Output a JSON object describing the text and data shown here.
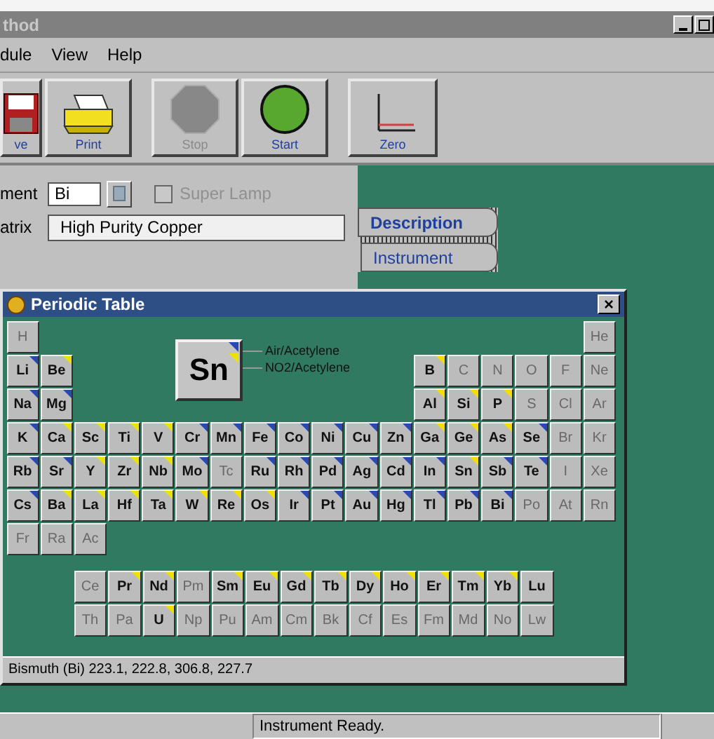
{
  "window": {
    "title": "thod"
  },
  "menu": [
    {
      "label": "dule"
    },
    {
      "label": "View"
    },
    {
      "label": "Help"
    }
  ],
  "toolbar": [
    {
      "kind": "save",
      "label": "ve",
      "disabled": false
    },
    {
      "kind": "print",
      "label": "Print",
      "disabled": false
    },
    {
      "kind": "stop",
      "label": "Stop",
      "disabled": true
    },
    {
      "kind": "start",
      "label": "Start",
      "disabled": false
    },
    {
      "kind": "zero",
      "label": "Zero",
      "disabled": false
    }
  ],
  "form": {
    "element_label": "ment",
    "element_value": "Bi",
    "super_lamp": {
      "label": "Super Lamp",
      "checked": false,
      "disabled": true
    },
    "matrix_label": "atrix",
    "matrix_value": "High Purity Copper"
  },
  "tabs": [
    {
      "label": "Description",
      "selected": true
    },
    {
      "label": "Instrument",
      "selected": false
    }
  ],
  "periodic_table": {
    "title": "Periodic Table",
    "close": "×",
    "selected_symbol": "Sn",
    "legend": [
      {
        "label": "Air/Acetylene",
        "color": "#2848b8"
      },
      {
        "label": "NO2/Acetylene",
        "color": "#f0e000"
      }
    ],
    "rows": [
      {
        "left": [
          {
            "symbol": "H",
            "disabled": true
          }
        ],
        "right": [
          {
            "symbol": "He",
            "disabled": true
          }
        ]
      },
      {
        "left": [
          {
            "symbol": "Li",
            "disabled": false,
            "color": "#2848b8"
          },
          {
            "symbol": "Be",
            "disabled": false,
            "color": "#f0e000"
          }
        ],
        "right": [
          {
            "symbol": "B",
            "disabled": false,
            "color": "#f0e000"
          },
          {
            "symbol": "C",
            "disabled": true
          },
          {
            "symbol": "N",
            "disabled": true
          },
          {
            "symbol": "O",
            "disabled": true
          },
          {
            "symbol": "F",
            "disabled": true
          },
          {
            "symbol": "Ne",
            "disabled": true
          }
        ]
      },
      {
        "left": [
          {
            "symbol": "Na",
            "disabled": false,
            "color": "#2848b8"
          },
          {
            "symbol": "Mg",
            "disabled": false,
            "color": "#2848b8"
          }
        ],
        "right": [
          {
            "symbol": "Al",
            "disabled": false,
            "color": "#f0e000"
          },
          {
            "symbol": "Si",
            "disabled": false,
            "color": "#f0e000"
          },
          {
            "symbol": "P",
            "disabled": false,
            "color": "#f0e000"
          },
          {
            "symbol": "S",
            "disabled": true
          },
          {
            "symbol": "Cl",
            "disabled": true
          },
          {
            "symbol": "Ar",
            "disabled": true
          }
        ]
      },
      {
        "left": [
          {
            "symbol": "K",
            "disabled": false,
            "color": "#2848b8"
          },
          {
            "symbol": "Ca",
            "disabled": false,
            "color": "#f0e000"
          },
          {
            "symbol": "Sc",
            "disabled": false,
            "color": "#f0e000"
          },
          {
            "symbol": "Ti",
            "disabled": false,
            "color": "#f0e000"
          },
          {
            "symbol": "V",
            "disabled": false,
            "color": "#f0e000"
          },
          {
            "symbol": "Cr",
            "disabled": false,
            "color": "#2848b8"
          },
          {
            "symbol": "Mn",
            "disabled": false,
            "color": "#2848b8"
          },
          {
            "symbol": "Fe",
            "disabled": false,
            "color": "#2848b8"
          },
          {
            "symbol": "Co",
            "disabled": false,
            "color": "#2848b8"
          },
          {
            "symbol": "Ni",
            "disabled": false,
            "color": "#2848b8"
          },
          {
            "symbol": "Cu",
            "disabled": false,
            "color": "#2848b8"
          },
          {
            "symbol": "Zn",
            "disabled": false,
            "color": "#2848b8"
          },
          {
            "symbol": "Ga",
            "disabled": false,
            "color": "#f0e000"
          },
          {
            "symbol": "Ge",
            "disabled": false,
            "color": "#f0e000"
          },
          {
            "symbol": "As",
            "disabled": false,
            "color": "#f0e000"
          },
          {
            "symbol": "Se",
            "disabled": false,
            "color": "#2848b8"
          },
          {
            "symbol": "Br",
            "disabled": true
          },
          {
            "symbol": "Kr",
            "disabled": true
          }
        ],
        "right": []
      },
      {
        "left": [
          {
            "symbol": "Rb",
            "disabled": false,
            "color": "#2848b8"
          },
          {
            "symbol": "Sr",
            "disabled": false,
            "color": "#2848b8"
          },
          {
            "symbol": "Y",
            "disabled": false,
            "color": "#f0e000"
          },
          {
            "symbol": "Zr",
            "disabled": false,
            "color": "#f0e000"
          },
          {
            "symbol": "Nb",
            "disabled": false,
            "color": "#f0e000"
          },
          {
            "symbol": "Mo",
            "disabled": false,
            "color": "#2848b8"
          },
          {
            "symbol": "Tc",
            "disabled": true
          },
          {
            "symbol": "Ru",
            "disabled": false,
            "color": "#2848b8"
          },
          {
            "symbol": "Rh",
            "disabled": false,
            "color": "#2848b8"
          },
          {
            "symbol": "Pd",
            "disabled": false,
            "color": "#2848b8"
          },
          {
            "symbol": "Ag",
            "disabled": false,
            "color": "#2848b8"
          },
          {
            "symbol": "Cd",
            "disabled": false,
            "color": "#2848b8"
          },
          {
            "symbol": "In",
            "disabled": false,
            "color": "#2848b8"
          },
          {
            "symbol": "Sn",
            "disabled": false,
            "color": "#f0e000"
          },
          {
            "symbol": "Sb",
            "disabled": false,
            "color": "#2848b8"
          },
          {
            "symbol": "Te",
            "disabled": false,
            "color": "#2848b8"
          },
          {
            "symbol": "I",
            "disabled": true
          },
          {
            "symbol": "Xe",
            "disabled": true
          }
        ],
        "right": []
      },
      {
        "left": [
          {
            "symbol": "Cs",
            "disabled": false,
            "color": "#2848b8"
          },
          {
            "symbol": "Ba",
            "disabled": false,
            "color": "#f0e000"
          },
          {
            "symbol": "La",
            "disabled": false,
            "color": "#f0e000"
          },
          {
            "symbol": "Hf",
            "disabled": false,
            "color": "#f0e000"
          },
          {
            "symbol": "Ta",
            "disabled": false,
            "color": "#f0e000"
          },
          {
            "symbol": "W",
            "disabled": false,
            "color": "#f0e000"
          },
          {
            "symbol": "Re",
            "disabled": false,
            "color": "#f0e000"
          },
          {
            "symbol": "Os",
            "disabled": false,
            "color": "#f0e000"
          },
          {
            "symbol": "Ir",
            "disabled": false,
            "color": "#2848b8"
          },
          {
            "symbol": "Pt",
            "disabled": false,
            "color": "#2848b8"
          },
          {
            "symbol": "Au",
            "disabled": false,
            "color": "#2848b8"
          },
          {
            "symbol": "Hg",
            "disabled": false,
            "color": "#2848b8"
          },
          {
            "symbol": "Tl",
            "disabled": false,
            "color": "#2848b8"
          },
          {
            "symbol": "Pb",
            "disabled": false,
            "color": "#2848b8"
          },
          {
            "symbol": "Bi",
            "disabled": false,
            "color": "#2848b8"
          },
          {
            "symbol": "Po",
            "disabled": true
          },
          {
            "symbol": "At",
            "disabled": true
          },
          {
            "symbol": "Rn",
            "disabled": true
          }
        ],
        "right": []
      },
      {
        "left": [
          {
            "symbol": "Fr",
            "disabled": true
          },
          {
            "symbol": "Ra",
            "disabled": true
          },
          {
            "symbol": "Ac",
            "disabled": true
          }
        ],
        "right": []
      }
    ],
    "f_block": [
      [
        {
          "symbol": "Ce",
          "disabled": true
        },
        {
          "symbol": "Pr",
          "disabled": false,
          "color": "#f0e000"
        },
        {
          "symbol": "Nd",
          "disabled": false,
          "color": "#f0e000"
        },
        {
          "symbol": "Pm",
          "disabled": true
        },
        {
          "symbol": "Sm",
          "disabled": false,
          "color": "#f0e000"
        },
        {
          "symbol": "Eu",
          "disabled": false,
          "color": "#f0e000"
        },
        {
          "symbol": "Gd",
          "disabled": false,
          "color": "#f0e000"
        },
        {
          "symbol": "Tb",
          "disabled": false,
          "color": "#f0e000"
        },
        {
          "symbol": "Dy",
          "disabled": false,
          "color": "#f0e000"
        },
        {
          "symbol": "Ho",
          "disabled": false,
          "color": "#f0e000"
        },
        {
          "symbol": "Er",
          "disabled": false,
          "color": "#f0e000"
        },
        {
          "symbol": "Tm",
          "disabled": false,
          "color": "#f0e000"
        },
        {
          "symbol": "Yb",
          "disabled": false,
          "color": "#f0e000"
        },
        {
          "symbol": "Lu",
          "disabled": false
        }
      ],
      [
        {
          "symbol": "Th",
          "disabled": true
        },
        {
          "symbol": "Pa",
          "disabled": true
        },
        {
          "symbol": "U",
          "disabled": false,
          "color": "#f0e000"
        },
        {
          "symbol": "Np",
          "disabled": true
        },
        {
          "symbol": "Pu",
          "disabled": true
        },
        {
          "symbol": "Am",
          "disabled": true
        },
        {
          "symbol": "Cm",
          "disabled": true
        },
        {
          "symbol": "Bk",
          "disabled": true
        },
        {
          "symbol": "Cf",
          "disabled": true
        },
        {
          "symbol": "Es",
          "disabled": true
        },
        {
          "symbol": "Fm",
          "disabled": true
        },
        {
          "symbol": "Md",
          "disabled": true
        },
        {
          "symbol": "No",
          "disabled": true
        },
        {
          "symbol": "Lw",
          "disabled": true
        }
      ]
    ],
    "info": "Bismuth (Bi) 223.1, 222.8, 306.8, 227.7"
  },
  "status_bar": {
    "message": "Instrument Ready."
  }
}
